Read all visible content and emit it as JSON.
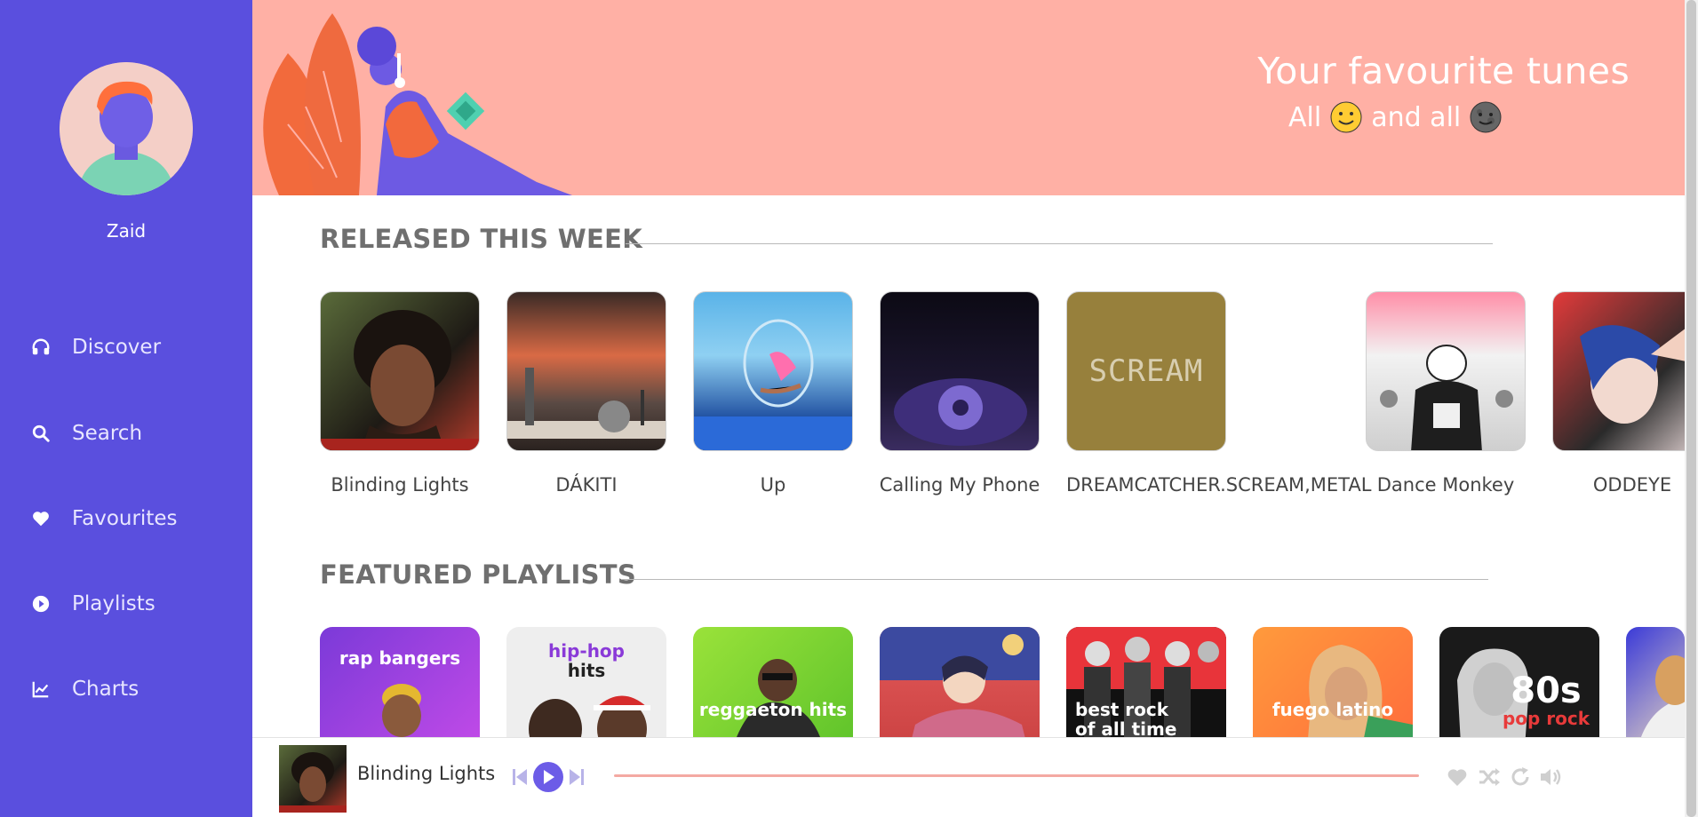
{
  "user": {
    "name": "Zaid"
  },
  "nav": {
    "items": [
      {
        "label": "Discover",
        "icon": "headphones-icon"
      },
      {
        "label": "Search",
        "icon": "search-icon"
      },
      {
        "label": "Favourites",
        "icon": "heart-icon"
      },
      {
        "label": "Playlists",
        "icon": "play-circle-icon"
      },
      {
        "label": "Charts",
        "icon": "line-chart-icon"
      }
    ]
  },
  "hero": {
    "title": "Your favourite tunes",
    "subtitle_prefix": "All",
    "subtitle_middle": "and all",
    "emojis": [
      "smiling-sun-emoji",
      "dark-moon-emoji"
    ]
  },
  "released": {
    "title": "RELEASED THIS WEEK",
    "items": [
      {
        "label": "Blinding Lights"
      },
      {
        "label": "DÁKITI"
      },
      {
        "label": "Up"
      },
      {
        "label": "Calling My Phone"
      },
      {
        "label": "DREAMCATCHER.SCREAM,METAL",
        "cover_text": "SCREAM"
      },
      {
        "label": "Dance Monkey"
      },
      {
        "label": "ODDEYE"
      }
    ]
  },
  "featured": {
    "title": "FEATURED PLAYLISTS",
    "items": [
      {
        "title": "rap bangers"
      },
      {
        "title_line1": "hip-hop",
        "title_line2": "hits"
      },
      {
        "title": "reggaeton hits"
      },
      {
        "title": ""
      },
      {
        "title_line1": "best rock",
        "title_line2": "of all time"
      },
      {
        "title": "fuego latino"
      },
      {
        "title_line1": "80s",
        "title_line2": "pop rock"
      },
      {
        "title": ""
      }
    ]
  },
  "player": {
    "song": "Blinding Lights",
    "controls": [
      "skip-back-icon",
      "play-icon",
      "skip-forward-icon"
    ],
    "actions": [
      "heart-icon",
      "shuffle-icon",
      "repeat-icon",
      "volume-icon"
    ]
  },
  "colors": {
    "sidebar": "#5a4fde",
    "hero": "#ffb0a5",
    "accent": "#6c5ce7",
    "progress": "#f4a9a2"
  }
}
